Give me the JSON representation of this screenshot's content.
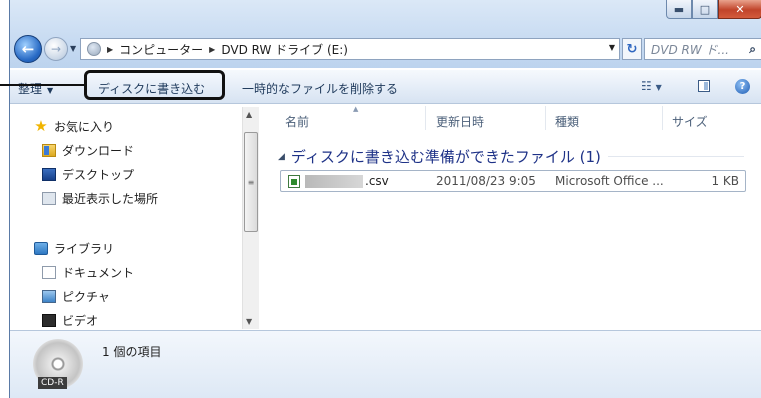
{
  "address_bar": {
    "segments": [
      "コンピューター",
      "DVD RW ドライブ (E:)"
    ]
  },
  "search": {
    "placeholder": "DVD RW ド..."
  },
  "command_bar": {
    "organize_label": "整理",
    "burn_label": "ディスクに書き込む",
    "delete_temp_label": "一時的なファイルを削除する"
  },
  "nav_pane": {
    "favorites": {
      "label": "お気に入り",
      "items": [
        "ダウンロード",
        "デスクトップ",
        "最近表示した場所"
      ]
    },
    "libraries": {
      "label": "ライブラリ",
      "items": [
        "ドキュメント",
        "ピクチャ",
        "ビデオ"
      ]
    }
  },
  "columns": {
    "name": "名前",
    "date": "更新日時",
    "type": "種類",
    "size": "サイズ"
  },
  "group": {
    "title": "ディスクに書き込む準備ができたファイル (1)"
  },
  "files": [
    {
      "name": ".csv",
      "date": "2011/08/23 9:05",
      "type": "Microsoft Office ...",
      "size": "1 KB"
    }
  ],
  "details": {
    "count": "1 個の項目",
    "disc_label": "CD-R"
  },
  "colors": {
    "accent": "#1e3287",
    "chrome": "#c9dcf2",
    "close": "#c1442a"
  }
}
